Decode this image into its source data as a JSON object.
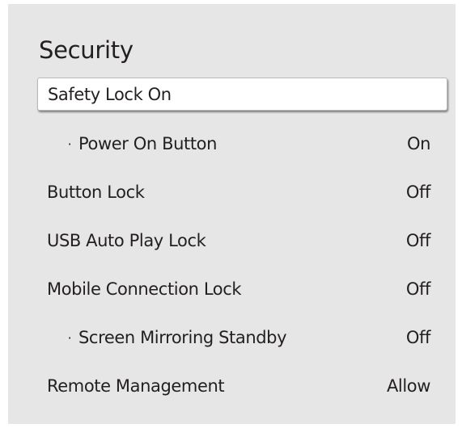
{
  "title": "Security",
  "items": [
    {
      "label": "Safety Lock On",
      "value": ""
    },
    {
      "label": "Power On Button",
      "value": "On",
      "sub_marker": "·"
    },
    {
      "label": "Button Lock",
      "value": "Off"
    },
    {
      "label": "USB Auto Play Lock",
      "value": "Off"
    },
    {
      "label": "Mobile Connection Lock",
      "value": "Off"
    },
    {
      "label": "Screen Mirroring Standby",
      "value": "Off",
      "sub_marker": "·"
    },
    {
      "label": "Remote Management",
      "value": "Allow"
    }
  ],
  "colors": {
    "panel_background": "#e6e6e6",
    "text": "#231f20",
    "selected_background": "#ffffff"
  }
}
